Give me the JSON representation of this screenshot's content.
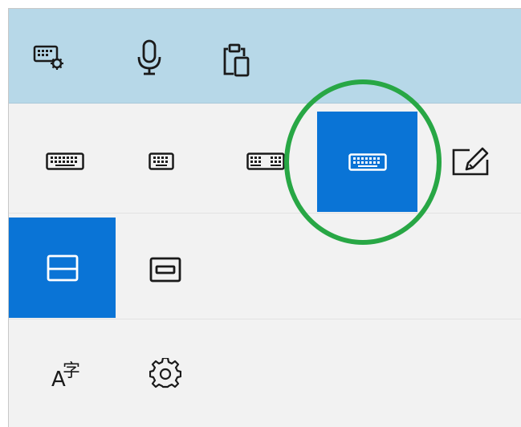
{
  "colors": {
    "topbar": "#b7d8e8",
    "panel": "#f2f2f2",
    "selected": "#0a74d6",
    "highlight_circle": "#28a745",
    "icon": "#1a1a1a"
  },
  "toolbar": {
    "items": [
      {
        "icon": "keyboard-settings-icon"
      },
      {
        "icon": "microphone-icon"
      },
      {
        "icon": "clipboard-icon"
      }
    ]
  },
  "layouts": {
    "items": [
      {
        "icon": "default-keyboard-icon",
        "selected": false
      },
      {
        "icon": "small-keyboard-icon",
        "selected": false
      },
      {
        "icon": "split-keyboard-icon",
        "selected": false
      },
      {
        "icon": "traditional-keyboard-icon",
        "selected": true
      },
      {
        "icon": "handwriting-icon",
        "selected": false
      }
    ]
  },
  "docking": {
    "items": [
      {
        "icon": "docked-keyboard-icon",
        "selected": true
      },
      {
        "icon": "undocked-keyboard-icon",
        "selected": false
      }
    ]
  },
  "settings": {
    "language_glyph_a": "A",
    "language_glyph_char": "字",
    "items": [
      {
        "icon": "language-icon"
      },
      {
        "icon": "gear-icon"
      }
    ]
  }
}
